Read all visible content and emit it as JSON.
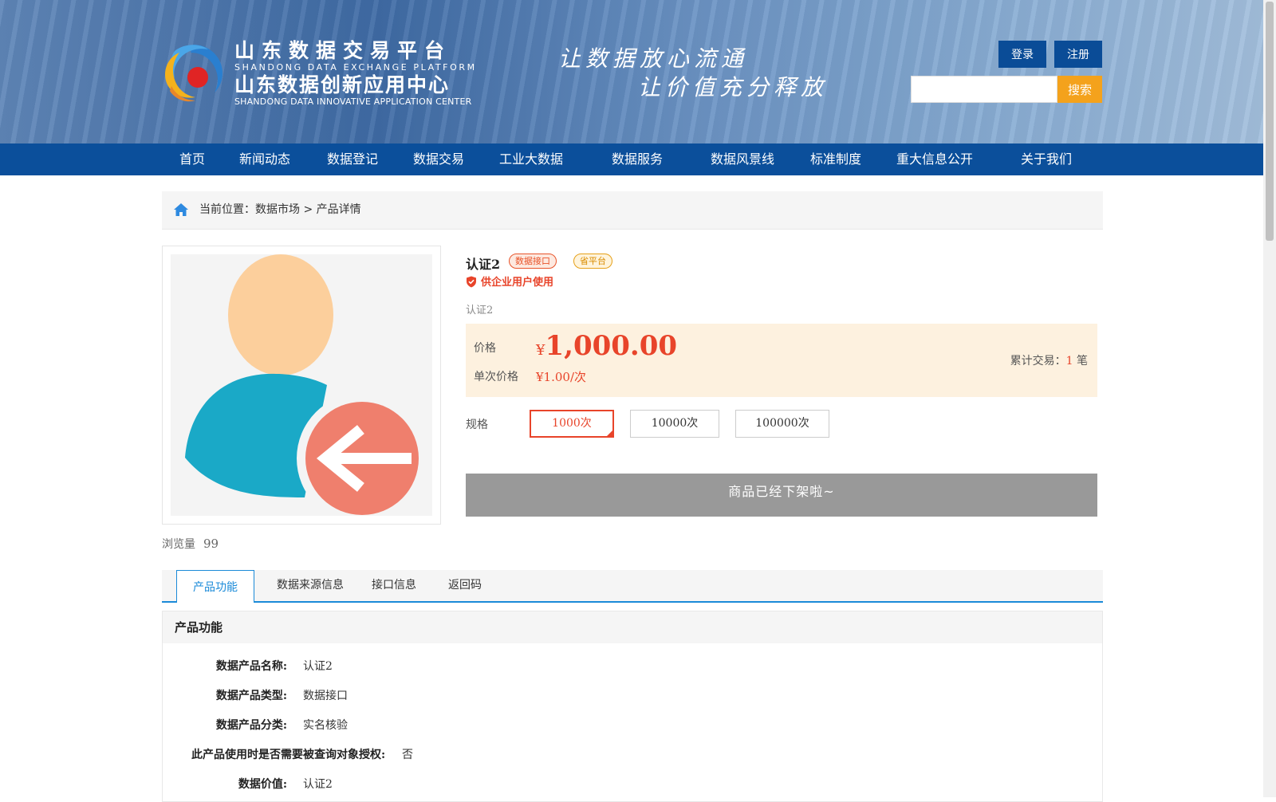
{
  "header": {
    "logo_cn_1": "山东数据交易平台",
    "logo_en_1": "SHANDONG DATA EXCHANGE PLATFORM",
    "logo_cn_2": "山东数据创新应用中心",
    "logo_en_2": "SHANDONG DATA INNOVATIVE APPLICATION CENTER",
    "slogan_1": "让数据放心流通",
    "slogan_2": "让价值充分释放",
    "login_label": "登录",
    "register_label": "注册",
    "search_placeholder": "",
    "search_label": "搜索"
  },
  "nav": {
    "items": [
      {
        "label": "首页"
      },
      {
        "label": "新闻动态"
      },
      {
        "label": "数据登记"
      },
      {
        "label": "数据交易"
      },
      {
        "label": "工业大数据"
      },
      {
        "label": "数据服务"
      },
      {
        "label": "数据风景线"
      },
      {
        "label": "标准制度"
      },
      {
        "label": "重大信息公开"
      },
      {
        "label": "关于我们"
      }
    ]
  },
  "breadcrumb": {
    "prefix": "当前位置：",
    "market": "数据市场",
    "separator": " > ",
    "current": "产品详情"
  },
  "product": {
    "views_label": "浏览量",
    "views_count": "99",
    "title": "认证2",
    "tag_api": "数据接口",
    "tag_platform": "省平台",
    "enterprise_only": "供企业用户使用",
    "description": "认证2",
    "price_label": "价格",
    "price_currency": "¥",
    "price_value": "1,000.00",
    "unit_price_label": "单次价格",
    "unit_price_value": "¥1.00/次",
    "cumulative_label": "累计交易：",
    "cumulative_count": "1",
    "cumulative_unit": " 笔",
    "spec_label": "规格",
    "specs": [
      {
        "label": "1000次",
        "selected": true
      },
      {
        "label": "10000次",
        "selected": false
      },
      {
        "label": "100000次",
        "selected": false
      }
    ],
    "offline_notice": "商品已经下架啦~"
  },
  "tabs": [
    {
      "label": "产品功能",
      "active": true
    },
    {
      "label": "数据来源信息",
      "active": false
    },
    {
      "label": "接口信息",
      "active": false
    },
    {
      "label": "返回码",
      "active": false
    }
  ],
  "features": {
    "title": "产品功能",
    "rows": [
      {
        "label": "数据产品名称:",
        "value": "认证2"
      },
      {
        "label": "数据产品类型:",
        "value": "数据接口"
      },
      {
        "label": "数据产品分类:",
        "value": "实名核验"
      },
      {
        "label": "此产品使用时是否需要被查询对象授权:",
        "value": "否"
      },
      {
        "label": "数据价值:",
        "value": "认证2"
      }
    ]
  },
  "colors": {
    "nav_bg": "#0b4f9b",
    "accent_red": "#e8442a",
    "search_orange": "#f4a21c",
    "tab_blue": "#1a8ad8"
  }
}
